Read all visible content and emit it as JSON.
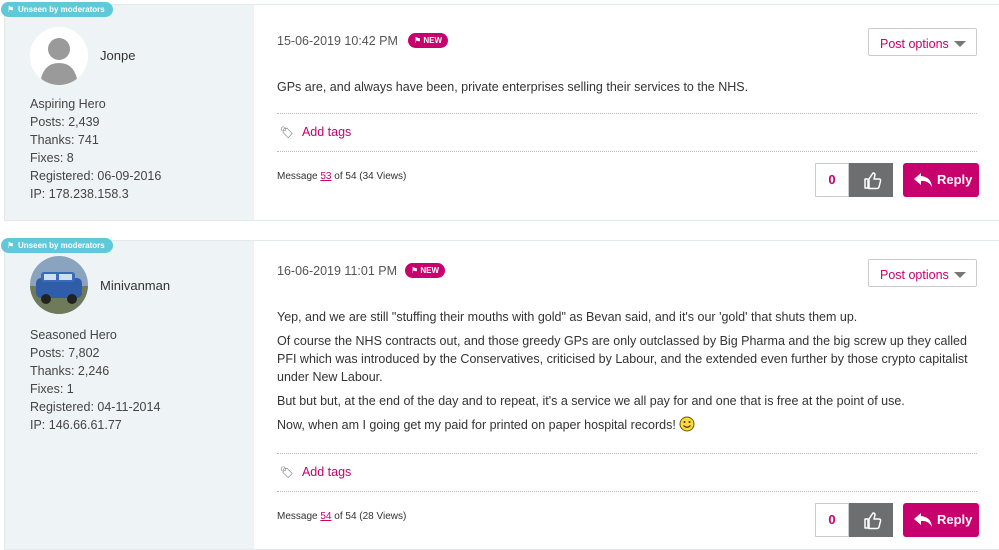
{
  "colors": {
    "accent": "#c8006e",
    "badge": "#5fc9d9",
    "sidebar": "#eef3f5",
    "kudo_button": "#6d6e70"
  },
  "posts": [
    {
      "badge": "Unseen by moderators",
      "username": "Jonpe",
      "rank": "Aspiring Hero",
      "posts": "Posts: 2,439",
      "thanks": "Thanks: 741",
      "fixes": "Fixes: 8",
      "registered": "Registered: 06-09-2016",
      "ip": "IP: 178.238.158.3",
      "date": "15-06-2019 10:42 PM",
      "new_label": "NEW",
      "post_options": "Post options",
      "body": [
        "GPs are, and always have been, private enterprises selling their services to the NHS."
      ],
      "add_tags": "Add tags",
      "message_prefix": "Message",
      "message_number": "53",
      "message_suffix": "of 54 (34 Views)",
      "kudos": "0",
      "reply": "Reply"
    },
    {
      "badge": "Unseen by moderators",
      "username": "Minivanman",
      "rank": "Seasoned Hero",
      "posts": "Posts: 7,802",
      "thanks": "Thanks: 2,246",
      "fixes": "Fixes: 1",
      "registered": "Registered: 04-11-2014",
      "ip": "IP: 146.66.61.77",
      "date": "16-06-2019 11:01 PM",
      "new_label": "NEW",
      "post_options": "Post options",
      "body": [
        "Yep, and we are still \"stuffing their mouths with gold\" as Bevan said, and it's our 'gold' that shuts them up.",
        "Of course the NHS contracts out, and those greedy GPs are only outclassed by Big Pharma and the big screw up they called PFI which was introduced by the Conservatives, criticised by Labour, and the extended even further by those crypto capitalist under New Labour.",
        "But but but, at the end of the day and to repeat, it's a service we all pay for and one that is free at the point of use.",
        "Now,  when am I going get my paid for printed on paper hospital records!"
      ],
      "add_tags": "Add tags",
      "message_prefix": "Message",
      "message_number": "54",
      "message_suffix": "of 54 (28 Views)",
      "kudos": "0",
      "reply": "Reply"
    }
  ]
}
